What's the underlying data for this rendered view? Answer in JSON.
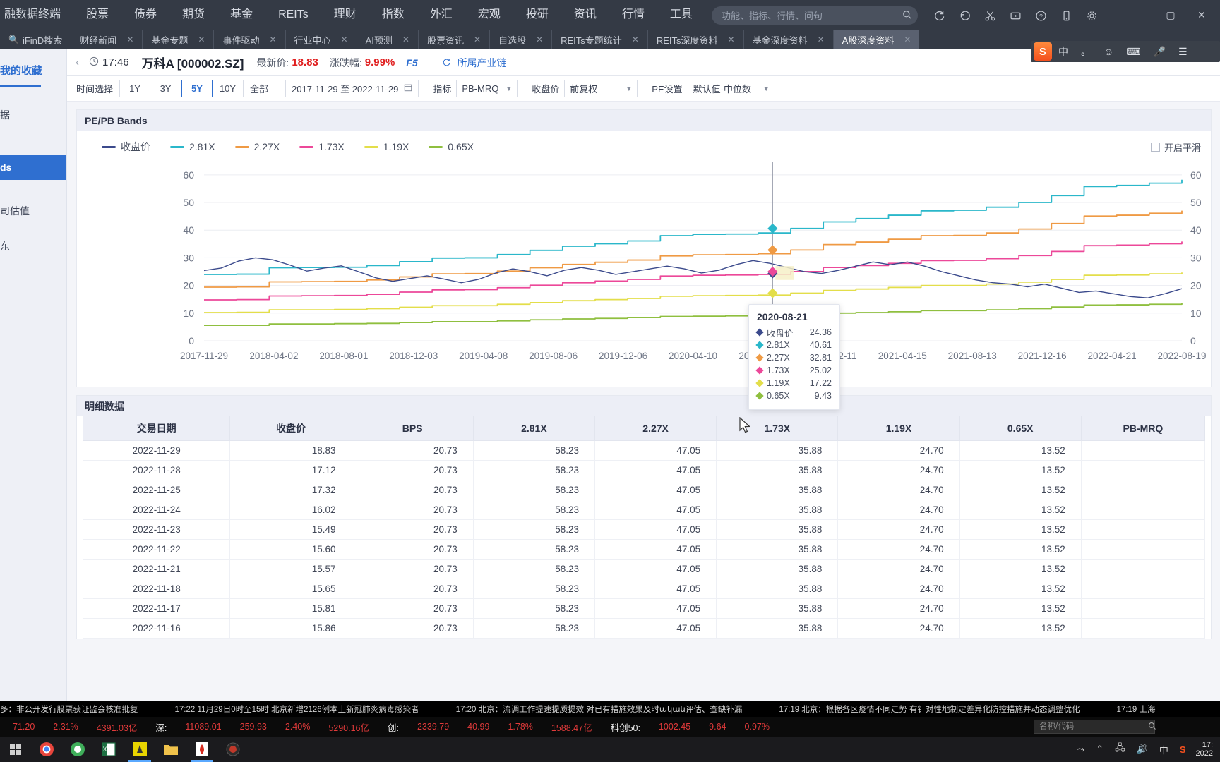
{
  "topbar": {
    "menu": [
      "融数据终端",
      "股票",
      "债券",
      "期货",
      "基金",
      "REITs",
      "理财",
      "指数",
      "外汇",
      "宏观",
      "投研",
      "资讯",
      "行情",
      "工具"
    ],
    "search_placeholder": "功能、指标、行情、问句",
    "search_value": "",
    "icons": [
      "refresh-icon",
      "history-icon",
      "scissors-icon",
      "video-icon",
      "help-icon",
      "mobile-icon",
      "settings-icon"
    ]
  },
  "tabs": [
    {
      "label": "iFinD搜索",
      "closable": false,
      "active": false,
      "icon": "search-icon"
    },
    {
      "label": "财经新闻",
      "closable": true,
      "active": false
    },
    {
      "label": "基金专题",
      "closable": true,
      "active": false
    },
    {
      "label": "事件驱动",
      "closable": true,
      "active": false
    },
    {
      "label": "行业中心",
      "closable": true,
      "active": false
    },
    {
      "label": "AI预测",
      "closable": true,
      "active": false
    },
    {
      "label": "股票资讯",
      "closable": true,
      "active": false
    },
    {
      "label": "自选股",
      "closable": true,
      "active": false
    },
    {
      "label": "REITs专题统计",
      "closable": true,
      "active": false
    },
    {
      "label": "REITs深度资料",
      "closable": true,
      "active": false
    },
    {
      "label": "基金深度资料",
      "closable": true,
      "active": false
    },
    {
      "label": "A股深度资料",
      "closable": true,
      "active": true
    }
  ],
  "ime": {
    "logo": "S",
    "items": [
      "中",
      "。",
      "☺",
      "⌨",
      "🎤"
    ]
  },
  "sidebar": {
    "favorites": "我的收藏",
    "items": [
      "据",
      "ds",
      "司估值",
      "东"
    ],
    "selected_index": 1
  },
  "stockbar": {
    "time": "17:46",
    "name": "万科A [000002.SZ]",
    "price_label": "最新价:",
    "price": "18.83",
    "change_label": "涨跌幅:",
    "change": "9.99%",
    "hotkey": "F5",
    "chain_link": "所属产业链"
  },
  "toolbar": {
    "time_label": "时间选择",
    "ranges": [
      "1Y",
      "3Y",
      "5Y",
      "10Y",
      "全部"
    ],
    "active_range": "5Y",
    "date_range": "2017-11-29 至 2022-11-29",
    "indicator_label": "指标",
    "indicator_value": "PB-MRQ",
    "price_label": "收盘价",
    "price_value": "前复权",
    "pe_label": "PE设置",
    "pe_value": "默认值-中位数"
  },
  "chart_card": {
    "title": "PE/PB Bands",
    "checkbox_label": "开启平滑",
    "checkbox_checked": false
  },
  "tooltip": {
    "date": "2020-08-21",
    "rows": [
      {
        "name": "收盘价",
        "value": "24.36",
        "color": "#3b4a8c"
      },
      {
        "name": "2.81X",
        "value": "40.61",
        "color": "#2ab7ca"
      },
      {
        "name": "2.27X",
        "value": "32.81",
        "color": "#ef9a44"
      },
      {
        "name": "1.73X",
        "value": "25.02",
        "color": "#ec4899"
      },
      {
        "name": "1.19X",
        "value": "17.22",
        "color": "#e3de4a"
      },
      {
        "name": "0.65X",
        "value": "9.43",
        "color": "#8fbf3f"
      }
    ]
  },
  "chart_data": {
    "type": "line",
    "title": "PE/PB Bands",
    "xlabel": "",
    "ylabel": "",
    "ylim": [
      0,
      62
    ],
    "yticks": [
      0,
      10,
      20,
      30,
      40,
      50,
      60
    ],
    "xticks": [
      "2017-11-29",
      "2018-04-02",
      "2018-08-01",
      "2018-12-03",
      "2019-04-08",
      "2019-08-06",
      "2019-12-06",
      "2020-04-10",
      "2020-08-11",
      "2020-12-11",
      "2021-04-15",
      "2021-08-13",
      "2021-12-16",
      "2022-04-21",
      "2022-08-19"
    ],
    "grid": true,
    "legend_position": "top-left",
    "legend": [
      "收盘价",
      "2.81X",
      "2.27X",
      "1.73X",
      "1.19X",
      "0.65X"
    ],
    "colors": {
      "收盘价": "#3b4a8c",
      "2.81X": "#2ab7ca",
      "2.27X": "#ef9a44",
      "1.73X": "#ec4899",
      "1.19X": "#e3de4a",
      "0.65X": "#8fbf3f"
    },
    "series": [
      {
        "name": "2.81X",
        "step": true,
        "values": [
          24.0,
          24.1,
          26.4,
          26.5,
          26.6,
          27.2,
          28.6,
          29.9,
          30.0,
          31.2,
          32.7,
          34.2,
          35.1,
          36.1,
          38.0,
          38.5,
          38.6,
          39.0,
          40.61,
          43.0,
          44.2,
          45.4,
          47.0,
          47.2,
          48.3,
          50.0,
          52.5,
          55.8,
          56.2,
          57.0,
          58.23
        ]
      },
      {
        "name": "2.27X",
        "step": true,
        "values": [
          19.4,
          19.5,
          21.3,
          21.4,
          21.5,
          22.0,
          23.1,
          24.2,
          24.3,
          25.2,
          26.4,
          27.6,
          28.4,
          29.2,
          30.7,
          31.1,
          31.2,
          31.5,
          32.81,
          34.8,
          35.7,
          36.7,
          38.0,
          38.1,
          39.0,
          40.4,
          42.4,
          45.1,
          45.4,
          46.1,
          47.05
        ]
      },
      {
        "name": "1.73X",
        "step": true,
        "values": [
          14.8,
          14.9,
          16.2,
          16.3,
          16.4,
          16.8,
          17.6,
          18.4,
          18.5,
          19.2,
          20.1,
          21.0,
          21.6,
          22.2,
          23.4,
          23.7,
          23.8,
          24.0,
          25.02,
          26.5,
          27.2,
          28.0,
          29.0,
          29.1,
          29.7,
          30.8,
          32.3,
          34.4,
          34.6,
          35.1,
          35.88
        ]
      },
      {
        "name": "1.19X",
        "step": true,
        "values": [
          10.2,
          10.3,
          11.2,
          11.2,
          11.3,
          11.6,
          12.1,
          12.7,
          12.7,
          13.2,
          13.8,
          14.5,
          14.9,
          15.3,
          16.1,
          16.3,
          16.4,
          16.5,
          17.22,
          18.2,
          18.7,
          19.3,
          20.0,
          20.0,
          20.5,
          21.2,
          22.2,
          23.7,
          23.8,
          24.2,
          24.7
        ]
      },
      {
        "name": "0.65X",
        "step": true,
        "values": [
          5.6,
          5.6,
          6.1,
          6.1,
          6.2,
          6.3,
          6.6,
          6.9,
          6.9,
          7.2,
          7.6,
          7.9,
          8.1,
          8.4,
          8.8,
          8.9,
          9.0,
          9.0,
          9.43,
          10.0,
          10.2,
          10.5,
          10.9,
          10.9,
          11.2,
          11.6,
          12.2,
          12.9,
          13.0,
          13.2,
          13.52
        ]
      },
      {
        "name": "收盘价",
        "step": false,
        "values": [
          25.4,
          26.3,
          28.8,
          30.0,
          29.3,
          27.4,
          25.2,
          26.3,
          27.1,
          25.0,
          22.8,
          21.5,
          22.5,
          23.5,
          22.3,
          21.0,
          22.2,
          24.5,
          26.0,
          25.0,
          23.5,
          25.5,
          26.5,
          25.5,
          24.0,
          25.0,
          26.0,
          27.0,
          26.0,
          24.5,
          25.5,
          27.5,
          29.0,
          28.0,
          26.5,
          25.0,
          24.36,
          25.5,
          27.0,
          28.5,
          27.5,
          28.5,
          27.0,
          25.0,
          23.5,
          22.0,
          21.0,
          20.5,
          19.5,
          20.5,
          19.0,
          17.5,
          18.0,
          17.0,
          16.0,
          15.5,
          17.0,
          18.83
        ]
      }
    ]
  },
  "table_card": {
    "title": "明细数据",
    "columns": [
      "交易日期",
      "收盘价",
      "BPS",
      "2.81X",
      "2.27X",
      "1.73X",
      "1.19X",
      "0.65X",
      "PB-MRQ"
    ],
    "rows": [
      [
        "2022-11-29",
        "18.83",
        "20.73",
        "58.23",
        "47.05",
        "35.88",
        "24.70",
        "13.52",
        ""
      ],
      [
        "2022-11-28",
        "17.12",
        "20.73",
        "58.23",
        "47.05",
        "35.88",
        "24.70",
        "13.52",
        ""
      ],
      [
        "2022-11-25",
        "17.32",
        "20.73",
        "58.23",
        "47.05",
        "35.88",
        "24.70",
        "13.52",
        ""
      ],
      [
        "2022-11-24",
        "16.02",
        "20.73",
        "58.23",
        "47.05",
        "35.88",
        "24.70",
        "13.52",
        ""
      ],
      [
        "2022-11-23",
        "15.49",
        "20.73",
        "58.23",
        "47.05",
        "35.88",
        "24.70",
        "13.52",
        ""
      ],
      [
        "2022-11-22",
        "15.60",
        "20.73",
        "58.23",
        "47.05",
        "35.88",
        "24.70",
        "13.52",
        ""
      ],
      [
        "2022-11-21",
        "15.57",
        "20.73",
        "58.23",
        "47.05",
        "35.88",
        "24.70",
        "13.52",
        ""
      ],
      [
        "2022-11-18",
        "15.65",
        "20.73",
        "58.23",
        "47.05",
        "35.88",
        "24.70",
        "13.52",
        ""
      ],
      [
        "2022-11-17",
        "15.81",
        "20.73",
        "58.23",
        "47.05",
        "35.88",
        "24.70",
        "13.52",
        ""
      ],
      [
        "2022-11-16",
        "15.86",
        "20.73",
        "58.23",
        "47.05",
        "35.88",
        "24.70",
        "13.52",
        ""
      ]
    ]
  },
  "news_ticker": [
    "多：非公开发行股票获证监会核准批复",
    "17:22 11月29日0时至15时 北京新增2126例本土新冠肺炎病毒感染者",
    "17:20 北京：流调工作提速提质提效 对已有措施效果及时ական评估、查缺补漏",
    "17:19 北京：根据各区疫情不同走势 有针对性地制定差异化防控措施并动态调整优化",
    "17:19 上海"
  ],
  "quotes": [
    {
      "text": "71.20",
      "style": "red"
    },
    {
      "text": "2.31%",
      "style": "red"
    },
    {
      "text": "4391.03亿",
      "style": "red"
    },
    {
      "text": "深:",
      "style": "lab"
    },
    {
      "text": "11089.01",
      "style": "red"
    },
    {
      "text": "259.93",
      "style": "red"
    },
    {
      "text": "2.40%",
      "style": "red"
    },
    {
      "text": "5290.16亿",
      "style": "red"
    },
    {
      "text": "创:",
      "style": "lab"
    },
    {
      "text": "2339.79",
      "style": "red"
    },
    {
      "text": "40.99",
      "style": "red"
    },
    {
      "text": "1.78%",
      "style": "red"
    },
    {
      "text": "1588.47亿",
      "style": "red"
    },
    {
      "text": "科创50:",
      "style": "lab"
    },
    {
      "text": "1002.45",
      "style": "red"
    },
    {
      "text": "9.64",
      "style": "red"
    },
    {
      "text": "0.97%",
      "style": "red"
    }
  ],
  "quote_search_placeholder": "名称/代码",
  "taskbar": {
    "clock_line1": "17:",
    "clock_line2": "2022",
    "apps": [
      "start-icon",
      "chrome-icon",
      "browser-icon",
      "excel-icon",
      "ifind-icon",
      "folder-icon",
      "pdf-icon",
      "record-icon"
    ]
  }
}
